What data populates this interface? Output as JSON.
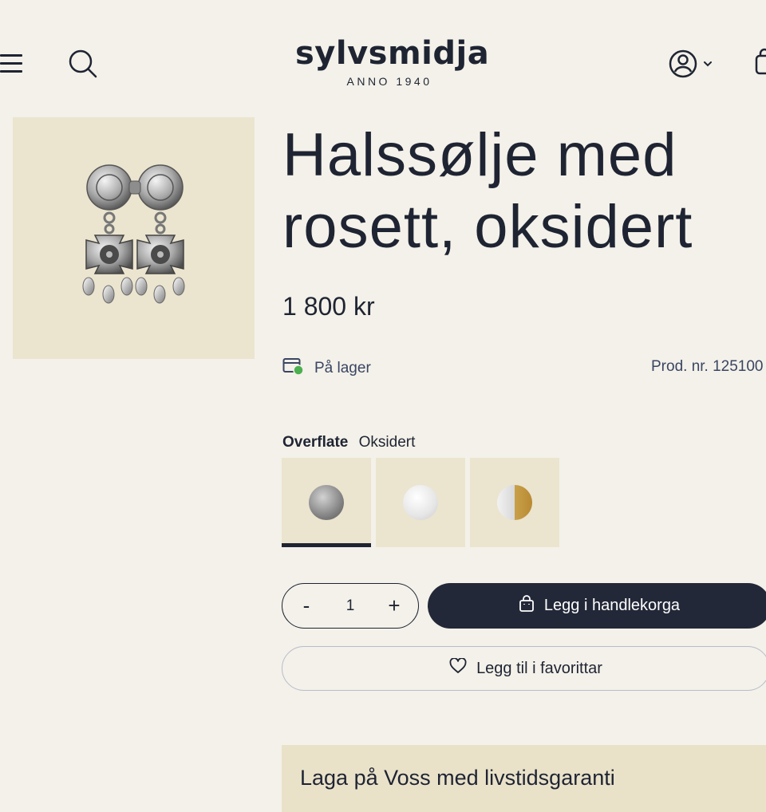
{
  "header": {
    "logo_text": "sylvsmidja",
    "logo_subtext": "ANNO 1940",
    "menu_icon": "hamburger-menu-icon",
    "search_icon": "search-icon",
    "account_icon": "user-account-icon",
    "cart_icon": "shopping-bag-icon"
  },
  "product": {
    "title": "Halssølje med rosett, oksidert",
    "price": "1 800 kr",
    "stock_status": "På lager",
    "product_number": "Prod. nr. 125100",
    "image_alt": "brooch-image"
  },
  "variant": {
    "label": "Overflate",
    "selected_value": "Oksidert",
    "options": [
      {
        "name": "oksidert",
        "color": "#8a8a8a"
      },
      {
        "name": "blank",
        "color": "#e2e2e2"
      },
      {
        "name": "forgylt",
        "color": "#c9a04a"
      }
    ]
  },
  "quantity": {
    "minus": "-",
    "value": "1",
    "plus": "+"
  },
  "actions": {
    "add_to_cart": "Legg i handlekorga",
    "add_to_favorites": "Legg til i favorittar"
  },
  "guarantee": {
    "text": "Laga på Voss med livstidsgaranti"
  },
  "colors": {
    "background": "#f3f1e9",
    "panel": "#ebe4cf",
    "primary": "#232838",
    "stock_green": "#4caf50"
  }
}
